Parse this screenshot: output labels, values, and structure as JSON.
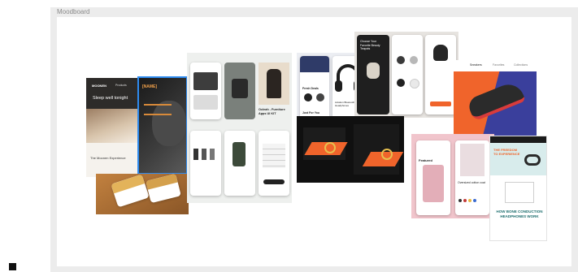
{
  "frame": {
    "title": "Moodboard"
  },
  "pillow": {
    "brand": "MOONEN",
    "nav": "Products",
    "heading": "Sleep well tonight",
    "footer_heading": "The Moonen Experience"
  },
  "portrait": {
    "badge": "[NAME]"
  },
  "furniture": {
    "title": "Ocleah - Furniture Apps UI KIT"
  },
  "headphones": {
    "title1": "Fresh Deals",
    "title2": "Just For You",
    "product": "Aviation Bluetooth Headphones"
  },
  "coffee": {
    "title": "Choose Your Favorite Beauty Teapots"
  },
  "shoe": {
    "tabs": [
      "Sneakers",
      "Favorites",
      "Collections"
    ]
  },
  "fashion": {
    "title": "Featured",
    "product": "Oversized cotton coat"
  },
  "bone": {
    "title": "THE FREEDOM TO EXPERIENCE",
    "heading": "HOW BONE CONDUCTION HEADPHONES WORK"
  },
  "colors": {
    "accent_orange": "#f0642b",
    "shoe_blue": "#3a3f9c",
    "selection_blue": "#2e8bef",
    "fashion_pink": "#e9b9c2"
  }
}
